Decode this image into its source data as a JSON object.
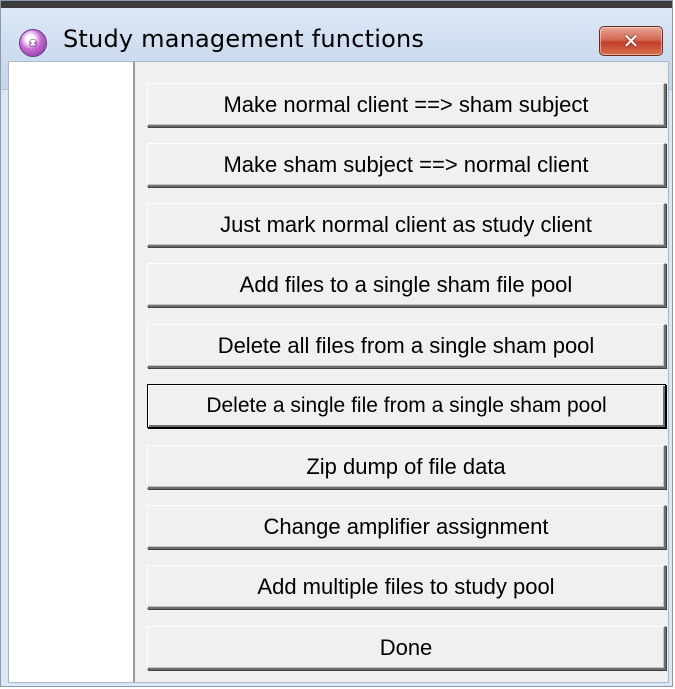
{
  "window": {
    "title": "Study management functions",
    "close_label": "✕"
  },
  "buttons": [
    {
      "label": "Make normal client ==> sham subject"
    },
    {
      "label": "Make sham subject ==> normal client"
    },
    {
      "label": "Just mark normal client as study client"
    },
    {
      "label": "Add files to a single sham file pool"
    },
    {
      "label": "Delete all files from a single sham pool"
    },
    {
      "label": "Delete a single file from a single sham pool"
    },
    {
      "label": "Zip dump of file data"
    },
    {
      "label": "Change amplifier assignment"
    },
    {
      "label": "Add multiple files to study pool"
    },
    {
      "label": "Done"
    }
  ]
}
